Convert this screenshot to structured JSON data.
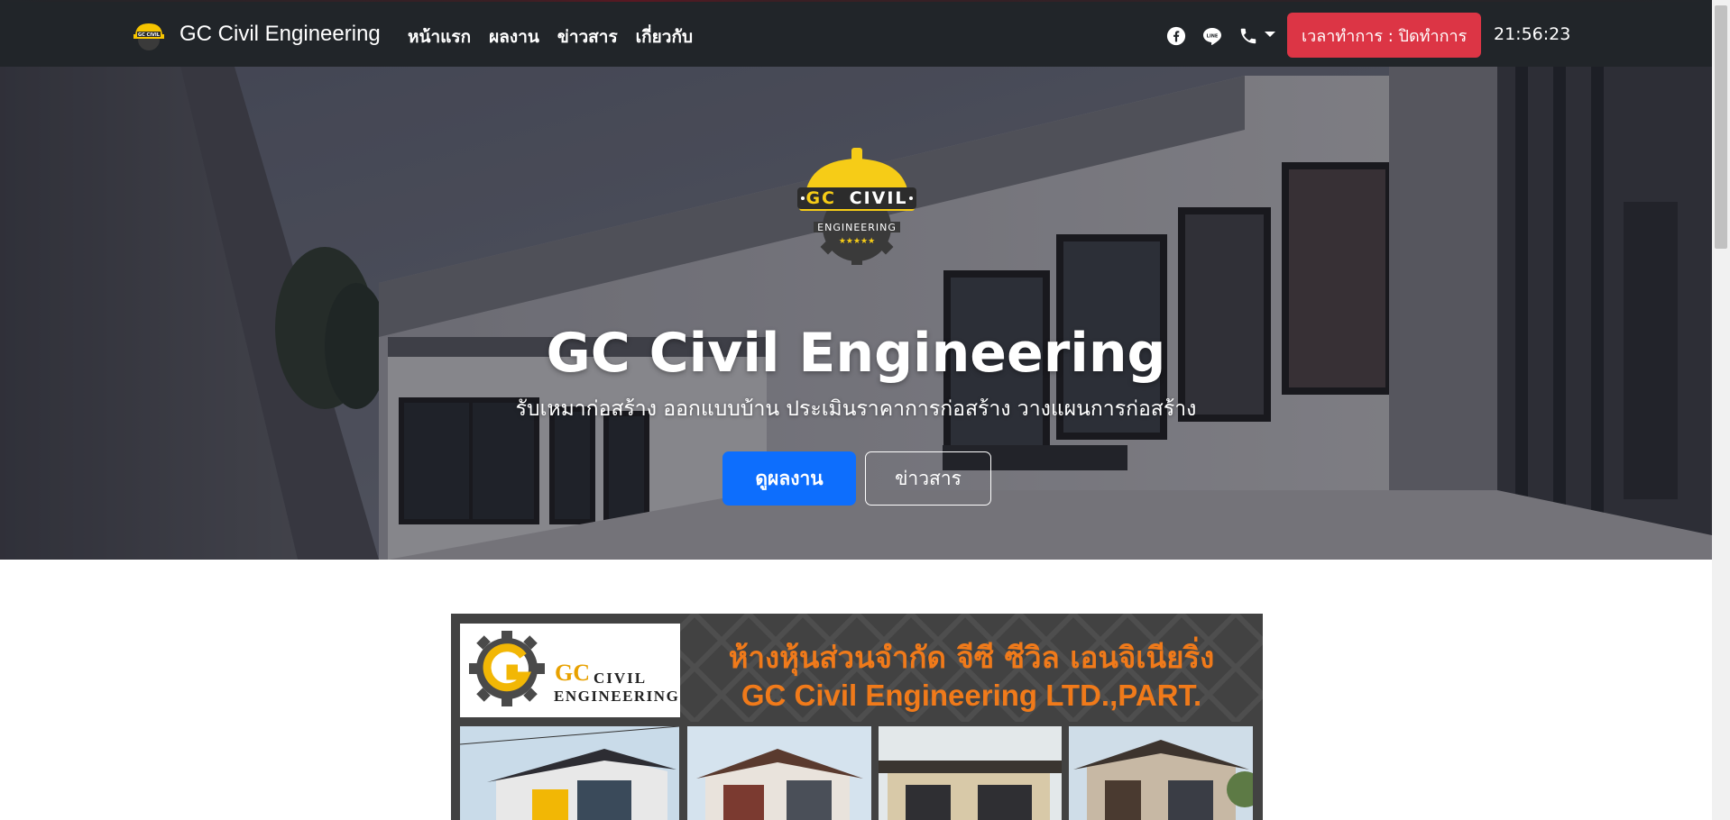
{
  "navbar": {
    "brand_name": "GC Civil Engineering",
    "links": [
      "หน้าแรก",
      "ผลงาน",
      "ข่าวสาร",
      "เกี่ยวกับ"
    ],
    "social_icons": [
      "facebook-icon",
      "line-icon",
      "phone-icon"
    ],
    "hours_label": "เวลาทำการ : ปิดทำการ",
    "clock": "21:56:23",
    "colors": {
      "background": "#212529",
      "hours_button": "#dc3545"
    }
  },
  "hero": {
    "logo_text_gc": "GC",
    "logo_text_civil": "CIVIL",
    "logo_text_engineering": "ENGINEERING",
    "logo_stars": "★★★★★",
    "title": "GC Civil Engineering",
    "subtitle": "รับเหมาก่อสร้าง ออกแบบบ้าน ประเมินราคาการก่อสร้าง วางแผนการก่อสร้าง",
    "primary_button": "ดูผลงาน",
    "secondary_button": "ข่าวสาร",
    "colors": {
      "primary_button": "#0d6efd"
    }
  },
  "banner": {
    "logo_gc": "GC",
    "logo_civil": "CIVIL",
    "logo_engineering": "ENGINEERING",
    "company_thai": "ห้างหุ้นส่วนจำกัด จีซี ซีวิล เอนจิเนียริ่ง",
    "company_en": "GC Civil Engineering LTD.,PART.",
    "colors": {
      "accent": "#f07a1a"
    }
  }
}
